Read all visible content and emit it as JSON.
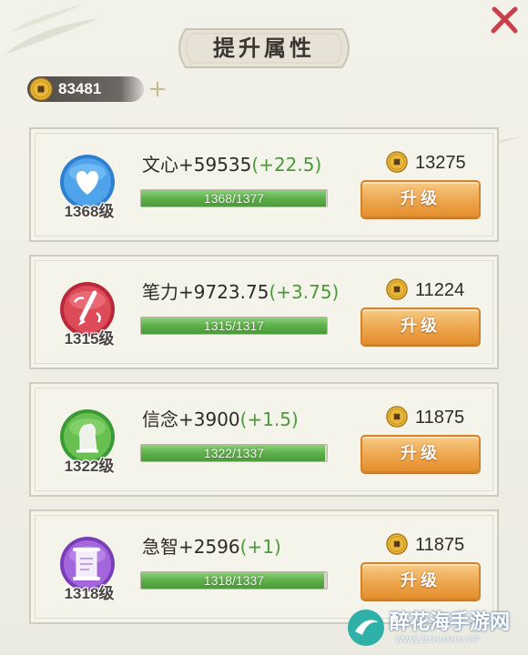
{
  "title": "提升属性",
  "currency": {
    "icon": "coin-icon",
    "amount": "83481",
    "add_icon": "plus-icon"
  },
  "close_icon": "close-icon",
  "colors": {
    "accent": "#eda64d",
    "progress": "#5db04a",
    "close": "#c8414a"
  },
  "attributes": [
    {
      "name": "文心",
      "value": "+59535",
      "increment": "(+22.5)",
      "level": "1368级",
      "progress": "1368/1377",
      "fraction": 0.9935,
      "cost": "13275",
      "button": "升级",
      "icon": "heart-icon"
    },
    {
      "name": "笔力",
      "value": "+9723.75",
      "increment": "(+3.75)",
      "level": "1315级",
      "progress": "1315/1317",
      "fraction": 0.9985,
      "cost": "11224",
      "button": "升级",
      "icon": "brush-icon"
    },
    {
      "name": "信念",
      "value": "+3900",
      "increment": "(+1.5)",
      "level": "1322级",
      "progress": "1322/1337",
      "fraction": 0.9888,
      "cost": "11875",
      "button": "升级",
      "icon": "statue-icon"
    },
    {
      "name": "急智",
      "value": "+2596",
      "increment": "(+1)",
      "level": "1318级",
      "progress": "1318/1337",
      "fraction": 0.9858,
      "cost": "11875",
      "button": "升级",
      "icon": "scroll-icon"
    }
  ],
  "watermark": {
    "text": "醉花海手游网",
    "sub": "WWW.ZUIHUAHAI.VIP"
  }
}
